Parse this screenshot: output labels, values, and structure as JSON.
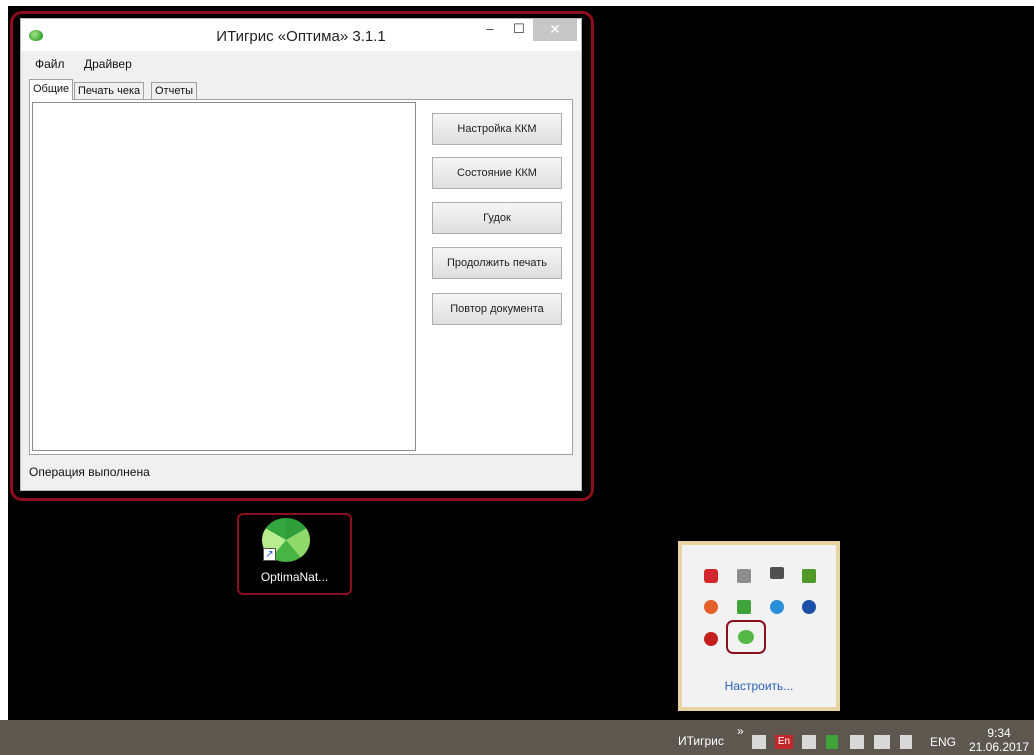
{
  "window": {
    "title": "ИТигрис «Оптима» 3.1.1",
    "minimize_glyph": "–",
    "maximize_glyph": "☐",
    "close_glyph": "✕"
  },
  "menu": {
    "file": "Файл",
    "driver": "Драйвер"
  },
  "tabs": [
    {
      "label": "Общие",
      "active": true
    },
    {
      "label": "Печать чека",
      "active": false
    },
    {
      "label": "Отчеты",
      "active": false
    }
  ],
  "actions": [
    {
      "label": "Настройка ККМ"
    },
    {
      "label": "Состояние ККМ"
    },
    {
      "label": "Гудок"
    },
    {
      "label": "Продолжить печать"
    },
    {
      "label": "Повтор документа"
    }
  ],
  "status_text": "Операция выполнена",
  "desktop_icon": {
    "label": "OptimaNat...",
    "shortcut_glyph": "↗"
  },
  "tray_popup": {
    "customize_label": "Настроить...",
    "icons": [
      {
        "name": "camera-record-icon",
        "color": "#d2272b"
      },
      {
        "name": "network-device-icon",
        "color": "#8c8c8c"
      },
      {
        "name": "monitor-icon",
        "color": "#505050"
      },
      {
        "name": "nvidia-icon",
        "color": "#4f9a2a"
      },
      {
        "name": "color-app-icon",
        "color": "#e4602a"
      },
      {
        "name": "green-shield-icon",
        "color": "#3fa33a"
      },
      {
        "name": "update-icon",
        "color": "#2a8fd8"
      },
      {
        "name": "bluetooth-icon",
        "color": "#1b4fa8"
      },
      {
        "name": "blocked-icon",
        "color": "#c41f1f"
      },
      {
        "name": "optima-tray-icon",
        "color": "#56b847"
      }
    ]
  },
  "taskbar": {
    "toolbar_label": "ИТигрис",
    "chevron_glyph": "»",
    "lang_indicator": "En",
    "lang": "ENG",
    "time": "9:34",
    "date": "21.06.2017"
  }
}
